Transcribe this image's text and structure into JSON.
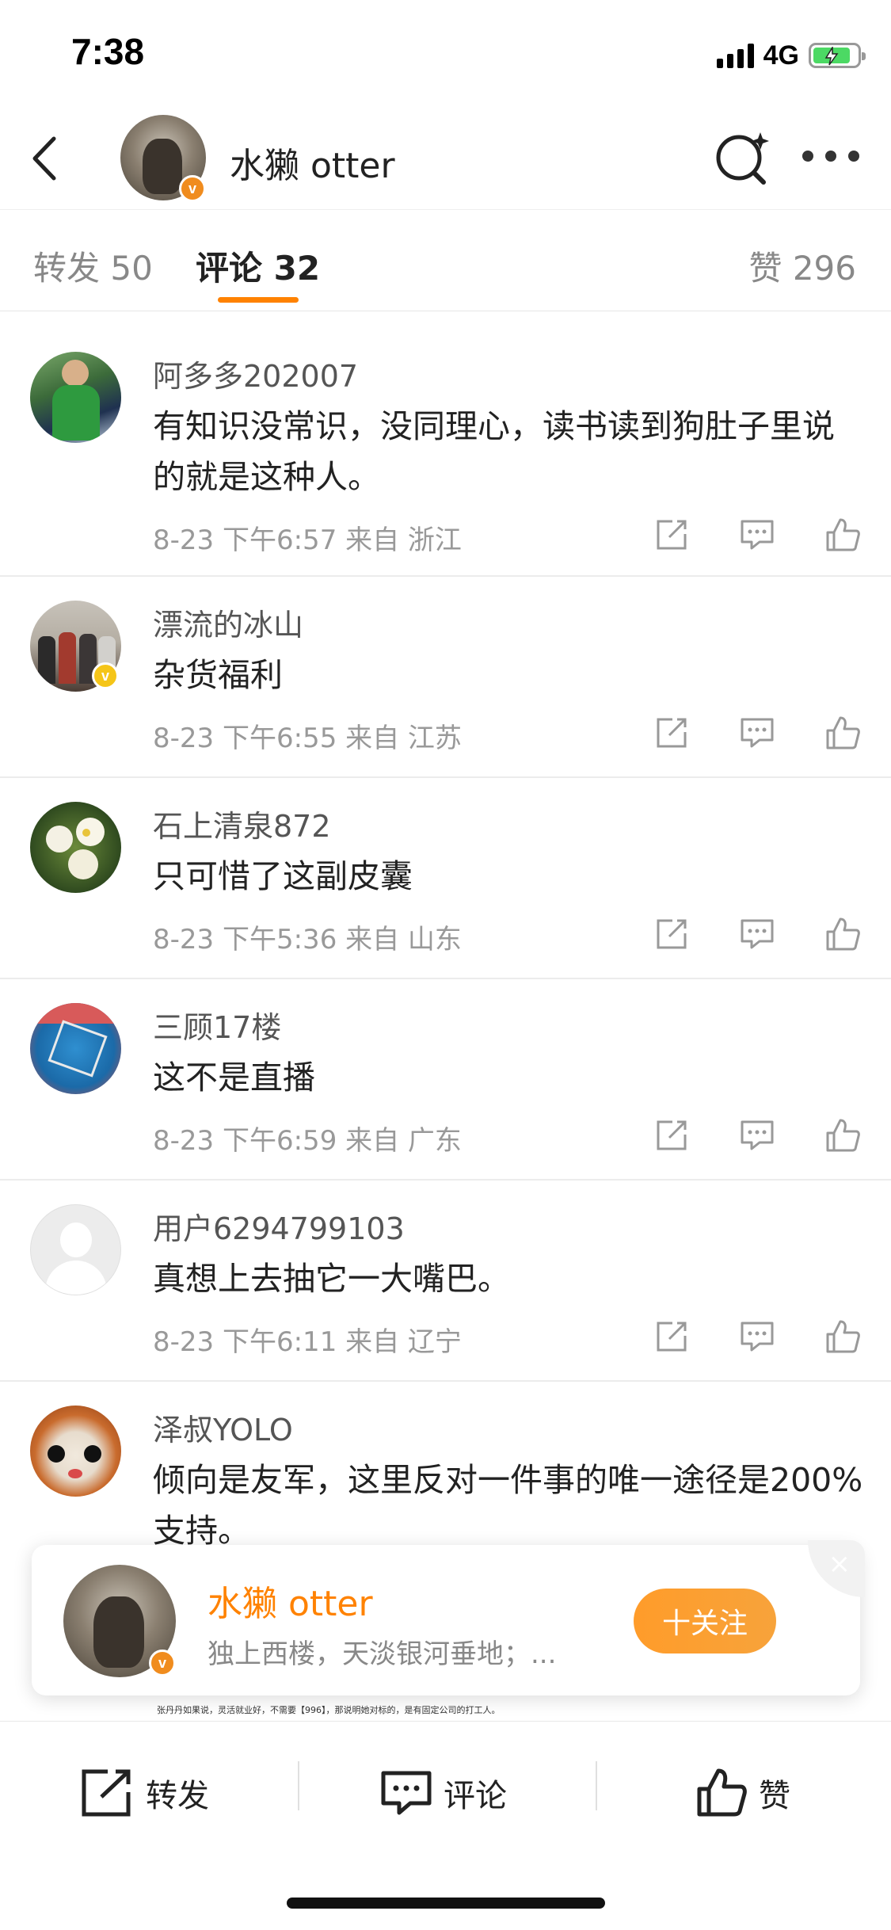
{
  "status_bar": {
    "time": "7:38",
    "network": "4G"
  },
  "header": {
    "title": "水獭 otter"
  },
  "tabs": {
    "repost": "转发 50",
    "comment": "评论 32",
    "like": "赞 296"
  },
  "comments": [
    {
      "name": "阿多多202007",
      "text": "有知识没常识，没同理心，读书读到狗肚子里说的就是这种人。",
      "meta": "8-23 下午6:57 来自 浙江"
    },
    {
      "name": "漂流的冰山",
      "text": "杂货福利",
      "meta": "8-23 下午6:55 来自 江苏"
    },
    {
      "name": "石上清泉872",
      "text": "只可惜了这副皮囊",
      "meta": "8-23 下午5:36 来自 山东"
    },
    {
      "name": "三顾17楼",
      "text": "这不是直播",
      "meta": "8-23 下午6:59 来自 广东"
    },
    {
      "name": "用户6294799103",
      "text": "真想上去抽它一大嘴巴。",
      "meta": "8-23 下午6:11 来自 辽宁"
    },
    {
      "name": "泽叔YOLO",
      "text": "倾向是友军，这里反对一件事的唯一途径是200%支持。",
      "meta": ""
    }
  ],
  "follow_card": {
    "name": "水獭 otter",
    "bio": "独上西楼，天淡银河垂地；...",
    "button": "十关注",
    "close": "×"
  },
  "behind_text": "张丹丹如果说，灵活就业好，不需要【996】，那说明她对标的，是有固定公司的打工人。",
  "bottom_bar": {
    "repost": "转发",
    "comment": "评论",
    "like": "赞"
  },
  "colors": {
    "accent": "#ff8200",
    "verified_orange": "#f08c1e",
    "verified_yellow": "#f5c518"
  }
}
